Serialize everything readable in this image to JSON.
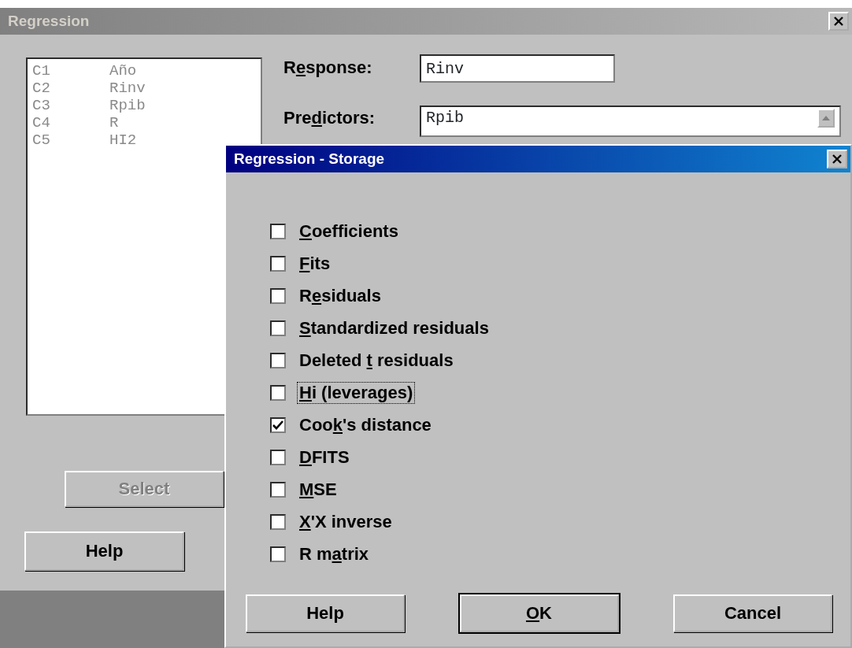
{
  "main_window": {
    "title": "Regression",
    "active": false,
    "columns_list": [
      {
        "column": "C1",
        "name": "Año"
      },
      {
        "column": "C2",
        "name": "Rinv"
      },
      {
        "column": "C3",
        "name": "Rpib"
      },
      {
        "column": "C4",
        "name": "R"
      },
      {
        "column": "C5",
        "name": "HI2"
      }
    ],
    "response": {
      "label": {
        "pre": "R",
        "key": "e",
        "post": "sponse:"
      },
      "value": "Rinv"
    },
    "predictors": {
      "label": {
        "pre": "Pre",
        "key": "d",
        "post": "ictors:"
      },
      "value": "Rpib"
    },
    "select_button": {
      "label": "Select",
      "disabled": true
    },
    "help_button": {
      "label": "Help"
    }
  },
  "storage_dialog": {
    "title": "Regression - Storage",
    "active": true,
    "options": [
      {
        "label": {
          "key": "C",
          "post": "oefficients"
        },
        "checked": false,
        "focused": false
      },
      {
        "label": {
          "key": "F",
          "post": "its"
        },
        "checked": false,
        "focused": false
      },
      {
        "label": {
          "pre": "R",
          "key": "e",
          "post": "siduals"
        },
        "checked": false,
        "focused": false
      },
      {
        "label": {
          "key": "S",
          "post": "tandardized residuals"
        },
        "checked": false,
        "focused": false
      },
      {
        "label": {
          "pre": "Deleted ",
          "key": "t",
          "post": " residuals"
        },
        "checked": false,
        "focused": false
      },
      {
        "label": {
          "key": "H",
          "post": "i (leverages)"
        },
        "checked": false,
        "focused": true
      },
      {
        "label": {
          "pre": "Coo",
          "key": "k",
          "post": "'s distance"
        },
        "checked": true,
        "focused": false
      },
      {
        "label": {
          "key": "D",
          "post": "FITS"
        },
        "checked": false,
        "focused": false
      },
      {
        "label": {
          "key": "M",
          "post": "SE"
        },
        "checked": false,
        "focused": false
      },
      {
        "label": {
          "key": "X",
          "post": "'X inverse"
        },
        "checked": false,
        "focused": false
      },
      {
        "label": {
          "pre": "R m",
          "key": "a",
          "post": "trix"
        },
        "checked": false,
        "focused": false
      }
    ],
    "buttons": [
      {
        "label": {
          "pre": "Help"
        },
        "default": false
      },
      {
        "label": {
          "key": "O",
          "post": "K"
        },
        "default": true
      },
      {
        "label": {
          "pre": "Cancel"
        },
        "default": false
      }
    ]
  }
}
